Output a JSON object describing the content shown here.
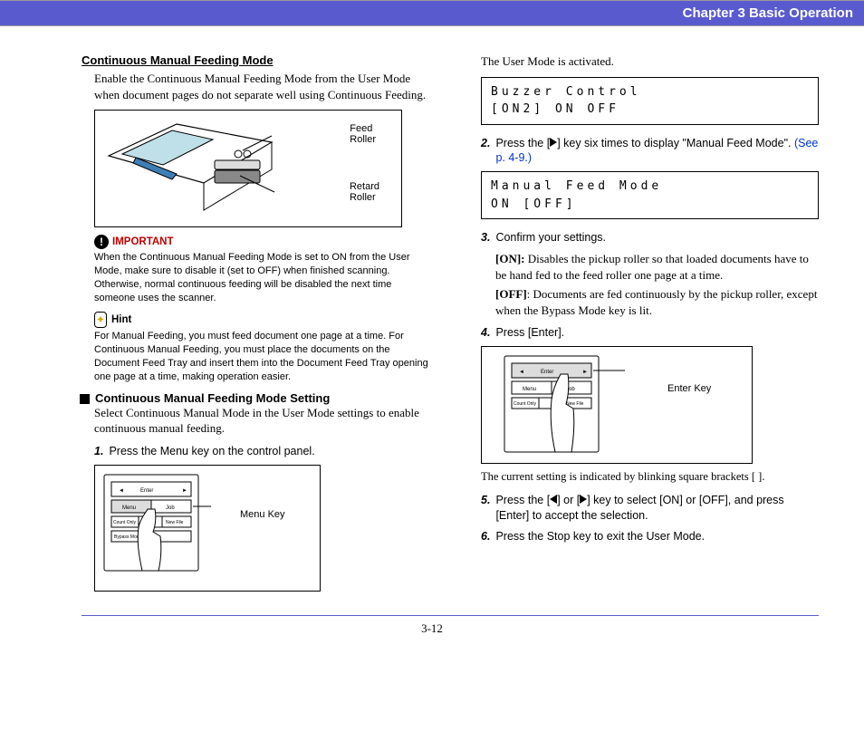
{
  "header": {
    "chapter": "Chapter 3   Basic Operation"
  },
  "left": {
    "title1": "Continuous Manual Feeding Mode",
    "intro1": "Enable the Continuous Manual Feeding Mode from the User Mode when document pages do not separate well using Continuous Feeding.",
    "fig1": {
      "feed": "Feed\nRoller",
      "retard": "Retard\nRoller"
    },
    "important_label": "IMPORTANT",
    "important_text": "When the Continuous Manual Feeding Mode is set to ON from the User Mode, make sure to disable it (set to OFF) when finished scanning. Otherwise, normal continuous feeding will be disabled the next time someone uses the scanner.",
    "hint_label": "Hint",
    "hint_text": "For Manual Feeding, you must feed document one page at a time. For Continuous Manual Feeding, you must place the documents on the Document Feed Tray and insert them into the Document Feed Tray opening one page at a time, making operation easier.",
    "title2": "Continuous Manual Feeding Mode Setting",
    "intro2": "Select Continuous Manual Mode in the User Mode settings to enable continuous manual feeding.",
    "step1": "Press the Menu key on the control panel.",
    "fig2": {
      "menu": "Menu Key"
    }
  },
  "right": {
    "line1": "The User Mode is activated.",
    "lcd1_l1": "Buzzer  Control",
    "lcd1_l2": " [ON2]  ON   OFF",
    "step2_a": "Press the [",
    "step2_b": "] key six times to display \"Manual Feed Mode\". ",
    "step2_link": "(See p. 4-9.)",
    "lcd2_l1": "Manual  Feed  Mode",
    "lcd2_l2": "   ON   [OFF]",
    "step3": "Confirm your settings.",
    "on_label": "[ON]:",
    "on_text": " Disables the pickup roller so that loaded documents have to be hand fed to the feed roller one page at a time.",
    "off_label": "[OFF]",
    "off_text": ": Documents are fed continuously by the pickup roller, except when the Bypass Mode key is lit.",
    "step4": "Press [Enter].",
    "fig3": {
      "enter": "Enter Key"
    },
    "caption4": "The current setting is indicated by blinking square brackets [ ].",
    "step5_a": "Press the [",
    "step5_b": "] or [",
    "step5_c": "] key to select [ON] or [OFF], and press [Enter] to accept the selection.",
    "step6": "Press the Stop key to exit the User Mode."
  },
  "footer": {
    "page": "3-12"
  }
}
